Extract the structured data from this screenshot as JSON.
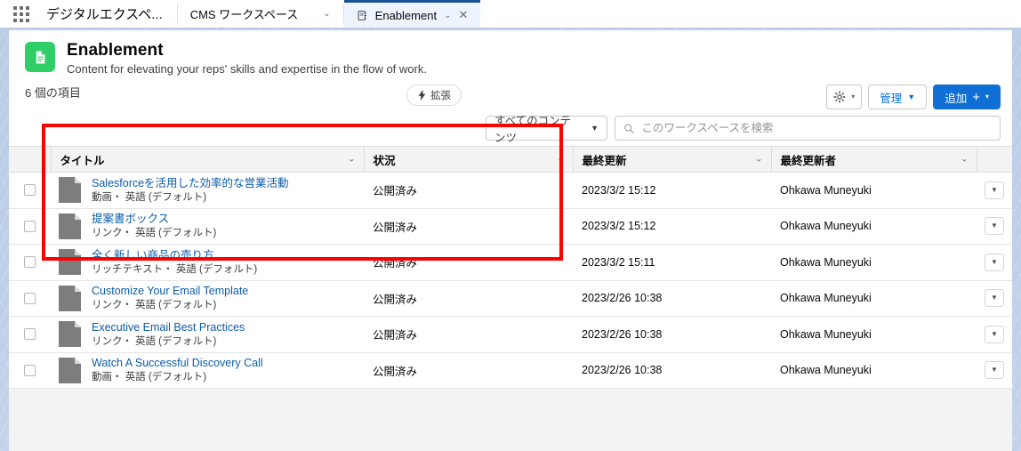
{
  "browser": {
    "app_launcher": "app-launcher",
    "app_title": "デジタルエクスペ...",
    "tabs": [
      {
        "label": "CMS ワークスペース",
        "active": false
      },
      {
        "label": "Enablement",
        "active": true
      }
    ]
  },
  "workspace": {
    "name": "Enablement",
    "description": "Content for elevating your reps' skills and expertise in the flow of work.",
    "item_count": "6 個の項目",
    "badge": "拡張",
    "icon_color": "#2fce66"
  },
  "toolbar": {
    "settings_label": "",
    "manage_label": "管理",
    "add_label": "追加",
    "primary_color": "#0f6fd4"
  },
  "filters": {
    "content_filter": "すべてのコンテンツ",
    "search_placeholder": "このワークスペースを検索",
    "search_value": ""
  },
  "table": {
    "columns": [
      "タイトル",
      "状況",
      "最終更新",
      "最終更新者"
    ],
    "rows": [
      {
        "title": "Salesforceを活用した効率的な営業活動",
        "subtitle": "動画・ 英語 (デフォルト)",
        "status": "公開済み",
        "modified": "2023/3/2 15:12",
        "modified_by": "Ohkawa Muneyuki"
      },
      {
        "title": "提案書ボックス",
        "subtitle": "リンク・ 英語 (デフォルト)",
        "status": "公開済み",
        "modified": "2023/3/2 15:12",
        "modified_by": "Ohkawa Muneyuki"
      },
      {
        "title": "全く新しい商品の売り方",
        "subtitle": "リッチテキスト・ 英語 (デフォルト)",
        "status": "公開済み",
        "modified": "2023/3/2 15:11",
        "modified_by": "Ohkawa Muneyuki"
      },
      {
        "title": "Customize Your Email Template",
        "subtitle": "リンク・ 英語 (デフォルト)",
        "status": "公開済み",
        "modified": "2023/2/26 10:38",
        "modified_by": "Ohkawa Muneyuki"
      },
      {
        "title": "Executive Email Best Practices",
        "subtitle": "リンク・ 英語 (デフォルト)",
        "status": "公開済み",
        "modified": "2023/2/26 10:38",
        "modified_by": "Ohkawa Muneyuki"
      },
      {
        "title": "Watch A Successful Discovery Call",
        "subtitle": "動画・ 英語 (デフォルト)",
        "status": "公開済み",
        "modified": "2023/2/26 10:38",
        "modified_by": "Ohkawa Muneyuki"
      }
    ]
  },
  "annotation": {
    "highlight_color": "#ff0000"
  }
}
